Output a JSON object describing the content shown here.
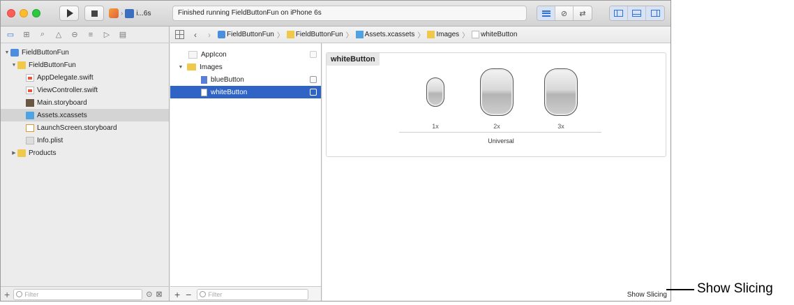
{
  "toolbar": {
    "scheme_device": "i...6s",
    "activity_text": "Finished running FieldButtonFun on iPhone 6s"
  },
  "navigator": {
    "tabs": [
      "folder-icon",
      "hierarchy-icon",
      "search-icon",
      "warning-icon",
      "test-icon",
      "debug-icon",
      "breakpoint-icon",
      "report-icon"
    ],
    "items": [
      {
        "label": "FieldButtonFun",
        "type": "proj"
      },
      {
        "label": "FieldButtonFun",
        "type": "folder"
      },
      {
        "label": "AppDelegate.swift",
        "type": "swift"
      },
      {
        "label": "ViewController.swift",
        "type": "swift"
      },
      {
        "label": "Main.storyboard",
        "type": "storyboard"
      },
      {
        "label": "Assets.xcassets",
        "type": "xcassets"
      },
      {
        "label": "LaunchScreen.storyboard",
        "type": "launch"
      },
      {
        "label": "Info.plist",
        "type": "plist"
      },
      {
        "label": "Products",
        "type": "folder"
      }
    ],
    "filter_placeholder": "Filter"
  },
  "jumpbar": {
    "crumbs": [
      "FieldButtonFun",
      "FieldButtonFun",
      "Assets.xcassets",
      "Images",
      "whiteButton"
    ]
  },
  "assets": {
    "items": [
      {
        "label": "AppIcon"
      },
      {
        "label": "Images"
      },
      {
        "label": "blueButton"
      },
      {
        "label": "whiteButton"
      }
    ],
    "filter_placeholder": "Filter",
    "add_label": "+",
    "remove_label": "−"
  },
  "editor": {
    "asset_name": "whiteButton",
    "scales": [
      "1x",
      "2x",
      "3x"
    ],
    "device_group": "Universal",
    "show_slicing": "Show Slicing"
  },
  "callout": {
    "text": "Show Slicing"
  }
}
